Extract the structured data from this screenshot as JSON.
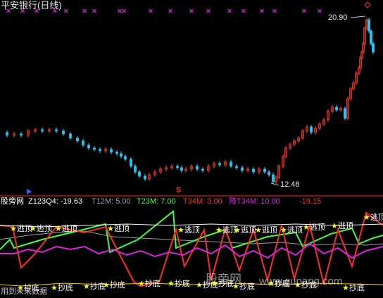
{
  "colors": {
    "background": "#000000",
    "candle_up": "#ff3b30",
    "candle_down": "#22c9f5",
    "divider": "#b01818",
    "line_z": "#ffffff",
    "line_t12": "#9aa0a6",
    "line_t23": "#3bff3b",
    "line_t34": "#ff2b2b",
    "line_jiang": "#e020e0",
    "star": "#ffff00",
    "label_escape": "#ffffff",
    "label_bottom": "#ffffff"
  },
  "main_panel": {
    "title": "平安银行(日线)",
    "high_marker": "20.90",
    "low_marker": "12.48",
    "s_marker": "S"
  },
  "indicator_panel": {
    "source_name": "股旁网",
    "readout": {
      "z": "Z123Q4: -19.63",
      "t12": "T12M: 5.00",
      "t23": "T23M: 7.00",
      "t34": "T34M: 3.00",
      "jiang": "降T34M: 10.00",
      "last": "-19.15"
    },
    "escape_label": "逃顶",
    "bottom_label": "抄底",
    "footer_text": "用到未来数据",
    "watermark": "股旁网",
    "watermark_url": "www.gupang.com"
  },
  "icons": {
    "x_markers": "x-mark-icon",
    "diamond": "diamond-icon",
    "star": "star-icon",
    "play": "play-triangle-icon"
  }
}
